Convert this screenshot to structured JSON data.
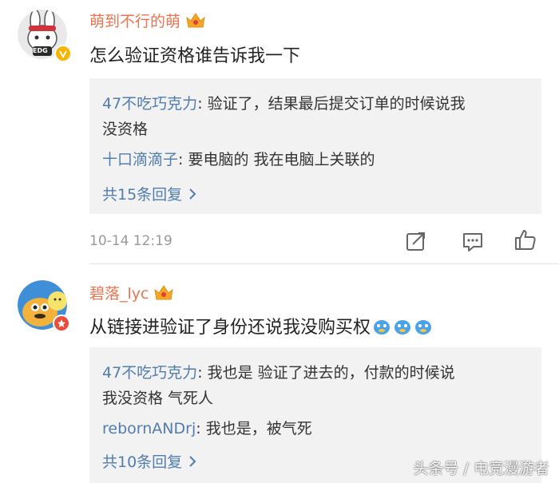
{
  "comments": [
    {
      "username": "萌到不行的萌",
      "text": "怎么验证资格谁告诉我一下",
      "avatar_badge_text": "EDG",
      "replies": [
        {
          "name": "47不吃巧克力",
          "sep": ": ",
          "line1": "验证了，结果最后提交订单的时候说我",
          "line2": "没资格"
        },
        {
          "name": "十口滴滴子",
          "sep": ": ",
          "line1": "要电脑的 我在电脑上关联的"
        }
      ],
      "reply_count": "共15条回复",
      "timestamp": "10-14 12:19"
    },
    {
      "username": "碧落_lyc",
      "text": "从链接进验证了身份还说我没购买权",
      "replies": [
        {
          "name": "47不吃巧克力",
          "sep": ": ",
          "line1": "我也是 验证了进去的，付款的时候说",
          "line2": "我没资格 气死人"
        },
        {
          "name": "rebornANDrj",
          "sep": ": ",
          "line1": "我也是，被气死"
        }
      ],
      "reply_count": "共10条回复"
    }
  ],
  "watermark": "头条号 / 电竞漫游者",
  "colors": {
    "username": "#eb7350",
    "link": "#507daf",
    "reply_bg": "#f2f2f2",
    "meta": "#999999"
  },
  "icons": [
    "crown-vip-icon",
    "verified-badge-icon",
    "repost-icon",
    "comment-icon",
    "like-icon",
    "chevron-right-icon",
    "emoji-doge-icon"
  ]
}
